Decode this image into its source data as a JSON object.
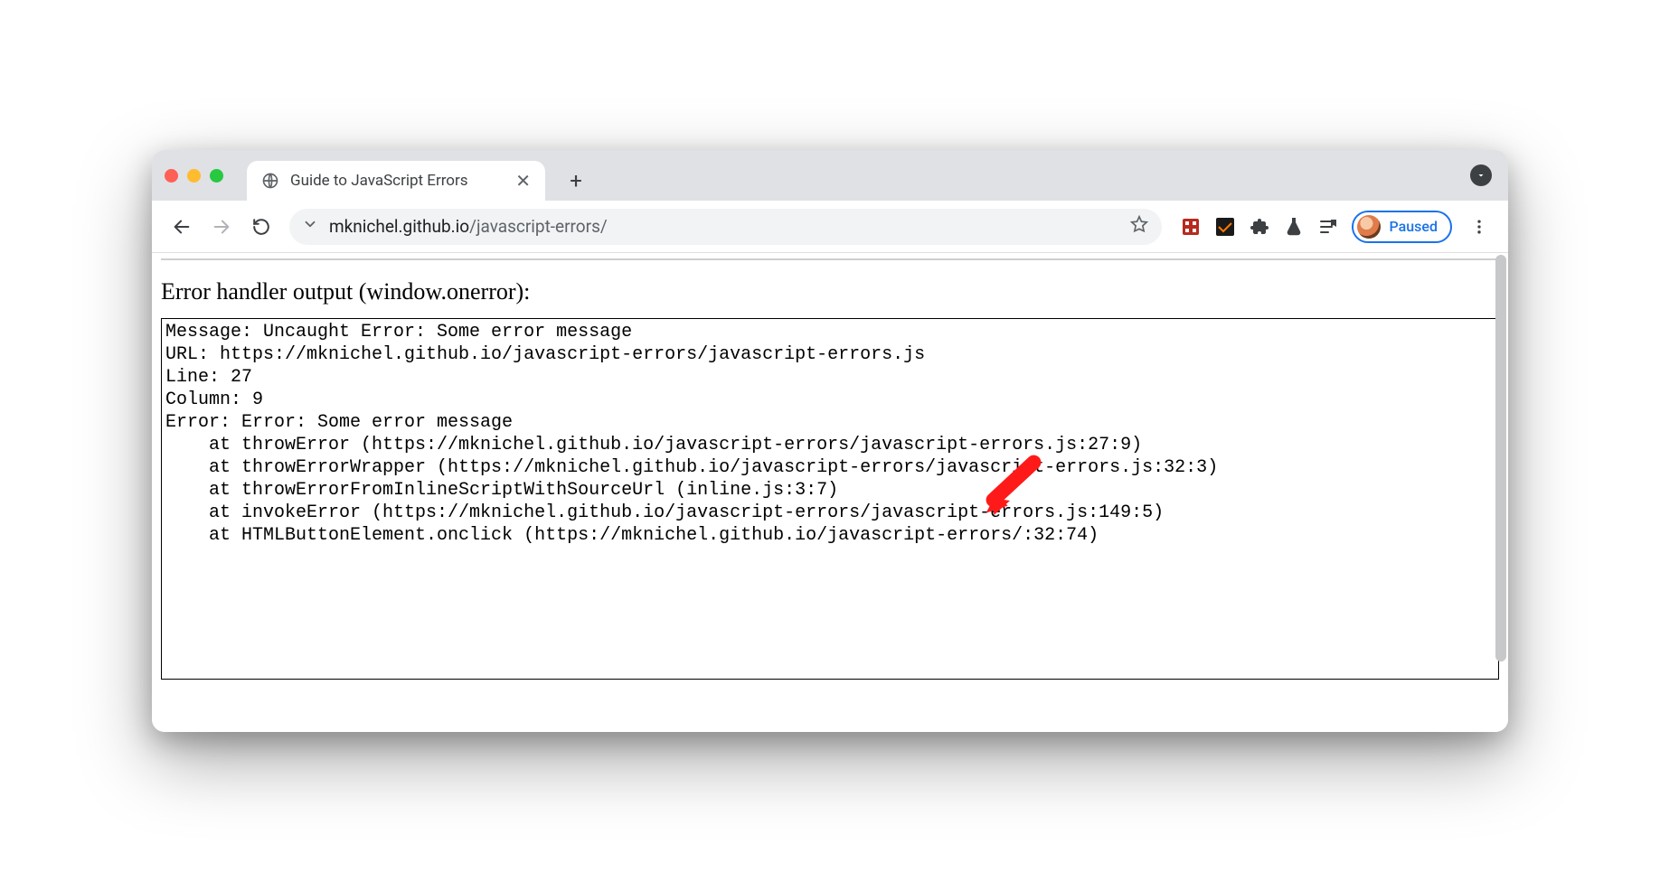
{
  "tab": {
    "title": "Guide to JavaScript Errors"
  },
  "omnibox": {
    "host": "mknichel.github.io",
    "path": "/javascript-errors/"
  },
  "profile": {
    "label": "Paused"
  },
  "page": {
    "heading": "Error handler output (window.onerror):",
    "output": "Message: Uncaught Error: Some error message\nURL: https://mknichel.github.io/javascript-errors/javascript-errors.js\nLine: 27\nColumn: 9\nError: Error: Some error message\n    at throwError (https://mknichel.github.io/javascript-errors/javascript-errors.js:27:9)\n    at throwErrorWrapper (https://mknichel.github.io/javascript-errors/javascript-errors.js:32:3)\n    at throwErrorFromInlineScriptWithSourceUrl (inline.js:3:7)\n    at invokeError (https://mknichel.github.io/javascript-errors/javascript-errors.js:149:5)\n    at HTMLButtonElement.onclick (https://mknichel.github.io/javascript-errors/:32:74)"
  }
}
